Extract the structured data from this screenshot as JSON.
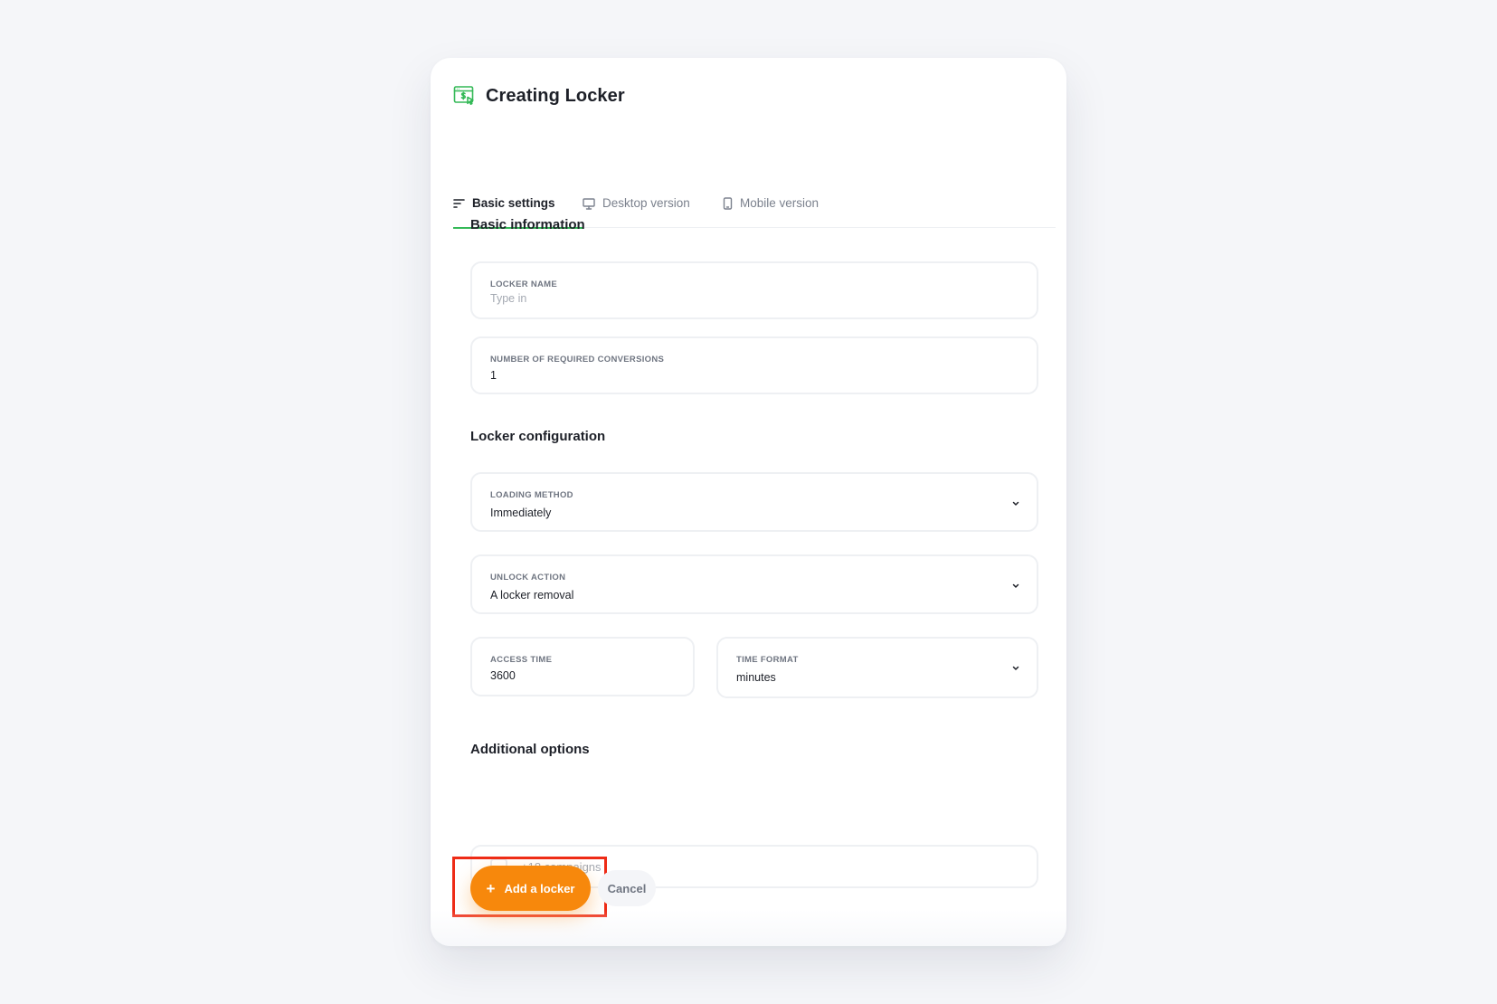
{
  "page": {
    "title": "Creating Locker"
  },
  "tabs": [
    {
      "label": "Basic settings",
      "icon": "sort-lines-icon",
      "active": true
    },
    {
      "label": "Desktop version",
      "icon": "monitor-icon",
      "active": false
    },
    {
      "label": "Mobile version",
      "icon": "phone-icon",
      "active": false
    }
  ],
  "sections": {
    "basic": "Basic information",
    "config": "Locker configuration",
    "additional": "Additional options"
  },
  "fields": {
    "locker_name": {
      "label": "Locker name",
      "placeholder": "Type in",
      "value": ""
    },
    "conversions": {
      "label": "Number of required conversions",
      "value": "1"
    },
    "loading_method": {
      "label": "Loading method",
      "value": "Immediately"
    },
    "unlock_action": {
      "label": "Unlock action",
      "value": "A locker removal"
    },
    "access_time": {
      "label": "Access time",
      "value": "3600"
    },
    "time_format": {
      "label": "Time format",
      "value": "minutes"
    }
  },
  "options": {
    "campaigns_label": "+18 campaigns",
    "checked": false
  },
  "actions": {
    "add_label": "Add a locker",
    "cancel_label": "Cancel"
  },
  "colors": {
    "accent": "#34b957",
    "primary_button": "#f7880c",
    "highlight": "#ee2b16"
  }
}
